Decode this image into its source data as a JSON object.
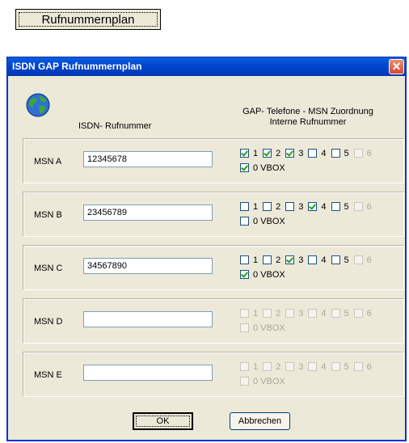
{
  "top_button": {
    "label": "Rufnummernplan"
  },
  "dialog": {
    "title": "ISDN GAP Rufnummernplan",
    "close_label": "✕",
    "col_isdn": "ISDN- Rufnummer",
    "col_gap_line1": "GAP- Telefone - MSN Zuordnung",
    "col_gap_line2": "Interne Rufnummer",
    "ok_label": "OK",
    "cancel_label": "Abbrechen",
    "icon": "globe-icon",
    "check_labels": [
      "1",
      "2",
      "3",
      "4",
      "5",
      "6",
      "0 VBOX"
    ],
    "rows": [
      {
        "label": "MSN A",
        "value": "12345678",
        "checks": [
          true,
          true,
          true,
          false,
          false,
          false
        ],
        "vbox": true,
        "enabled": true
      },
      {
        "label": "MSN B",
        "value": "23456789",
        "checks": [
          false,
          false,
          false,
          true,
          false,
          false
        ],
        "vbox": false,
        "enabled": true
      },
      {
        "label": "MSN C",
        "value": "34567890",
        "checks": [
          false,
          false,
          true,
          false,
          false,
          false
        ],
        "vbox": true,
        "enabled": true
      },
      {
        "label": "MSN D",
        "value": "",
        "checks": [
          false,
          false,
          false,
          false,
          false,
          false
        ],
        "vbox": false,
        "enabled": false
      },
      {
        "label": "MSN E",
        "value": "",
        "checks": [
          false,
          false,
          false,
          false,
          false,
          false
        ],
        "vbox": false,
        "enabled": false
      }
    ]
  }
}
